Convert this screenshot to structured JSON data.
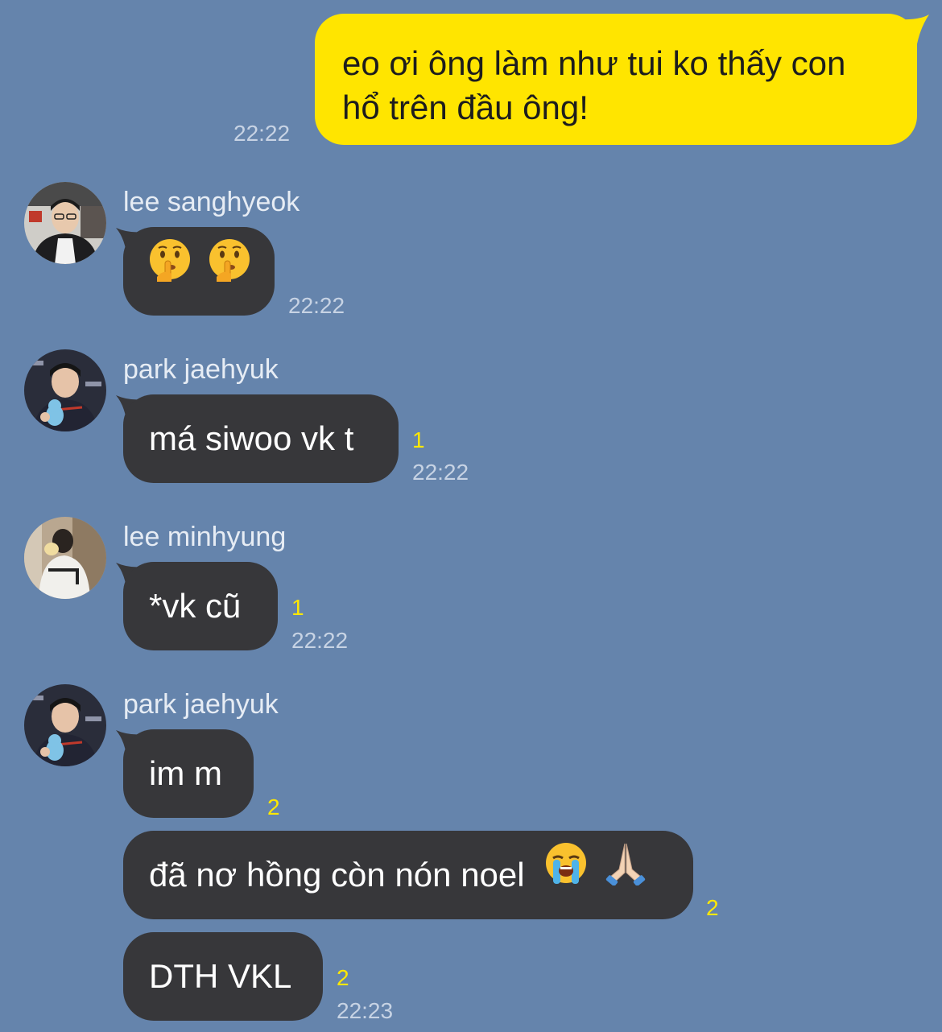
{
  "chat": {
    "outgoing": {
      "text": "eo ơi ông làm như tui ko thấy con hổ trên đầu ông!",
      "time": "22:22"
    },
    "groups": [
      {
        "sender": "lee sanghyeok",
        "avatar_icon": "profile-photo-icon",
        "messages": [
          {
            "text": "",
            "emojis": [
              "shushing-face-icon",
              "shushing-face-icon"
            ],
            "time": "22:22",
            "unread": ""
          }
        ]
      },
      {
        "sender": "park jaehyuk",
        "avatar_icon": "profile-photo-icon",
        "messages": [
          {
            "text": "má siwoo vk t",
            "time": "22:22",
            "unread": "1"
          }
        ]
      },
      {
        "sender": "lee minhyung",
        "avatar_icon": "profile-photo-icon",
        "messages": [
          {
            "text": "*vk cũ",
            "time": "22:22",
            "unread": "1"
          }
        ]
      },
      {
        "sender": "park jaehyuk",
        "avatar_icon": "profile-photo-icon",
        "messages": [
          {
            "text": "im m",
            "time": "",
            "unread": "2"
          },
          {
            "text": "đã nơ hồng còn nón noel",
            "emojis": [
              "loudly-crying-face-icon",
              "folded-hands-icon"
            ],
            "time": "",
            "unread": "2"
          },
          {
            "text": "DTH VKL",
            "time": "22:23",
            "unread": "2"
          }
        ]
      }
    ]
  },
  "colors": {
    "background": "#6584ac",
    "outgoing_bubble": "#ffe500",
    "incoming_bubble": "#37373a",
    "unread_count": "#ffe800"
  }
}
